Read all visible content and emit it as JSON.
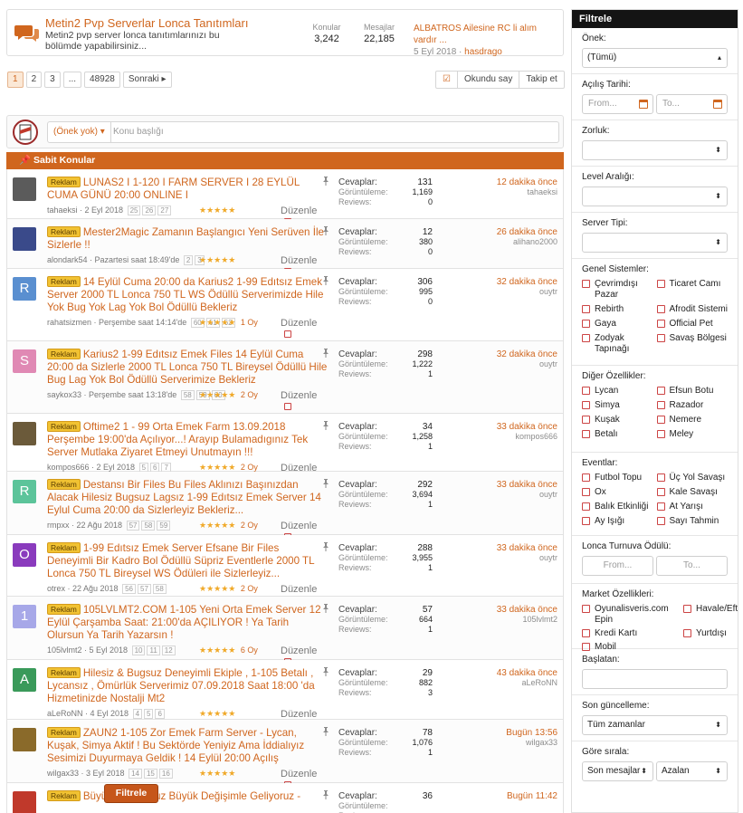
{
  "forum": {
    "title": "Metin2 Pvp Serverlar Lonca Tanıtımları",
    "description": "Metin2 pvp server lonca tanıtımlarınızı bu bölümde yapabilirsiniz...",
    "topics_label": "Konular",
    "topics_value": "3,242",
    "messages_label": "Mesajlar",
    "messages_value": "22,185",
    "last_title": "ALBATROS Ailesine RC li alım vardır ...",
    "last_date": "5 Eyl 2018",
    "last_user": "hasdrago"
  },
  "pagination": {
    "pages": [
      "1",
      "2",
      "3",
      "...",
      "48928"
    ],
    "next": "Sonraki"
  },
  "tools": {
    "mark_read": "Okundu say",
    "follow": "Takip et"
  },
  "search": {
    "prefix": "(Önek yok)",
    "placeholder": "Konu başlığı"
  },
  "sticky_header": "Sabit Konular",
  "stat_labels": {
    "replies": "Cevaplar:",
    "views": "Görüntüleme:",
    "reviews": "Reviews:"
  },
  "edit_label": "Düzenle",
  "badge_label": "Reklam",
  "threads": [
    {
      "title": "LUNAS2 I 1-120 I FARM SERVER I 28 EYLÜL CUMA GÜNÜ 20:00 ONLINE I",
      "author": "tahaeksi",
      "date": "2 Eyl 2018",
      "pages": [
        "25",
        "26",
        "27"
      ],
      "votes": "",
      "replies": "131",
      "views": "1,169",
      "reviews": "0",
      "last_time": "12 dakika önce",
      "last_user": "tahaeksi",
      "avatar_letter": "",
      "avatar_color": "#5b5b5b",
      "height": 55
    },
    {
      "title": "Mester2Magic Zamanın Başlangıcı Yeni Serüven İle Sizlerle !!",
      "author": "alondark54",
      "date": "Pazartesi saat 18:49'de",
      "pages": [
        "2",
        "3"
      ],
      "votes": "",
      "replies": "12",
      "views": "380",
      "reviews": "0",
      "last_time": "26 dakika önce",
      "last_user": "alihano2000",
      "avatar_letter": "",
      "avatar_color": "#3a4a8a",
      "height": 55
    },
    {
      "title": "14 Eylül Cuma 20:00 da Karius2 1-99 Edıtsız Emek Server 2000 TL Lonca 750 TL WS Ödüllü Serverimizde Hile Yok Bug Yok Lag Yok Bol Ödüllü Bekleriz",
      "author": "rahatsizmen",
      "date": "Perşembe saat 14:14'de",
      "pages": [
        "60",
        "61",
        "62"
      ],
      "votes": "1 Oy",
      "replies": "306",
      "views": "995",
      "reviews": "0",
      "last_time": "32 dakika önce",
      "last_user": "ouytr",
      "avatar_letter": "R",
      "avatar_color": "#5a8fd0",
      "height": 80
    },
    {
      "title": "Karius2 1-99 Edıtsız Emek Files 14 Eylül Cuma 20:00 da Sizlerle 2000 TL Lonca 750 TL Bireysel Ödüllü Hile Bug Lag Yok Bol Ödüllü Serverimize Bekleriz",
      "author": "saykox33",
      "date": "Perşembe saat 13:18'de",
      "pages": [
        "58",
        "59",
        "60"
      ],
      "votes": "2 Oy",
      "replies": "298",
      "views": "1,222",
      "reviews": "1",
      "last_time": "32 dakika önce",
      "last_user": "ouytr",
      "avatar_letter": "S",
      "avatar_color": "#e089b4",
      "height": 80
    },
    {
      "title": "Oftime2 1 - 99 Orta Emek Farm 13.09.2018 Perşembe 19:00'da Açılıyor...! Arayıp Bulamadıgınız Tek Server Mutlaka Ziyaret Etmeyi Unutmayın !!!",
      "author": "kompos666",
      "date": "2 Eyl 2018",
      "pages": [
        "5",
        "6",
        "7"
      ],
      "votes": "2 Oy",
      "replies": "34",
      "views": "1,258",
      "reviews": "1",
      "last_time": "33 dakika önce",
      "last_user": "kompos666",
      "avatar_letter": "",
      "avatar_color": "#6b5a3a",
      "height": 64
    },
    {
      "title": "Destansı Bir Files Bu Files Aklınızı Başınızdan Alacak Hilesiz Bugsuz Lagsız 1-99 Edıtsız Emek Server 14 Eylul Cuma 20:00 da Sizlerleyiz Bekleriz...",
      "author": "rmpxx",
      "date": "22 Ağu 2018",
      "pages": [
        "57",
        "58",
        "59"
      ],
      "votes": "2 Oy",
      "replies": "292",
      "views": "3,694",
      "reviews": "1",
      "last_time": "33 dakika önce",
      "last_user": "ouytr",
      "avatar_letter": "R",
      "avatar_color": "#5cc49a",
      "height": 70
    },
    {
      "title": "1-99 Edıtsız Emek Server Efsane Bir Files Deneyimli Bir Kadro Bol Ödüllü Süpriz Eventlerle 2000 TL Lonca 750 TL Bireysel WS Ödüleri ile Sizlerleyiz...",
      "author": "otrex",
      "date": "22 Ağu 2018",
      "pages": [
        "56",
        "57",
        "58"
      ],
      "votes": "2 Oy",
      "replies": "288",
      "views": "3,955",
      "reviews": "1",
      "last_time": "33 dakika önce",
      "last_user": "ouytr",
      "avatar_letter": "O",
      "avatar_color": "#8a3bbd",
      "height": 68
    },
    {
      "title": "105LVLMT2.COM 1-105 Yeni Orta Emek Server 12 Eylül Çarşamba Saat: 21:00'da AÇILIYOR ! Ya Tarih Olursun Ya Tarih Yazarsın !",
      "author": "105lvlmt2",
      "date": "5 Eyl 2018",
      "pages": [
        "10",
        "11",
        "12"
      ],
      "votes": "6 Oy",
      "replies": "57",
      "views": "664",
      "reviews": "1",
      "last_time": "33 dakika önce",
      "last_user": "105lvlmt2",
      "avatar_letter": "1",
      "avatar_color": "#a7a8e8",
      "height": 70
    },
    {
      "title": "Hilesiz & Bugsuz Deneyimli Ekiple , 1-105 Betalı , Lycansız , Ömürlük Serverimiz 07.09.2018 Saat 18:00 'da Hizmetinizde Nostalji Mt2",
      "author": "aLeRoNN",
      "date": "4 Eyl 2018",
      "pages": [
        "4",
        "5",
        "6"
      ],
      "votes": "",
      "replies": "29",
      "views": "882",
      "reviews": "3",
      "last_time": "43 dakika önce",
      "last_user": "aLeRoNN",
      "avatar_letter": "A",
      "avatar_color": "#3a9a5a",
      "height": 66
    },
    {
      "title": "ZAUN2 1-105 Zor Emek Farm Server - Lycan, Kuşak, Simya Aktif ! Bu Sektörde Yeniyiz Ama İddialıyız Sesimizi Duyurmaya Geldik ! 14 Eylül 20:00 Açılış",
      "author": "wilgax33",
      "date": "3 Eyl 2018",
      "pages": [
        "14",
        "15",
        "16"
      ],
      "votes": "",
      "replies": "78",
      "views": "1,076",
      "reviews": "1",
      "last_time": "Bugün 13:56",
      "last_user": "wilgax33",
      "avatar_letter": "",
      "avatar_color": "#8a6a2a",
      "height": 70
    },
    {
      "title": "Büyük Oynuyoruz Büyük Değişimle Geliyoruz -",
      "author": "",
      "date": "",
      "pages": [],
      "votes": "",
      "replies": "36",
      "views": "",
      "reviews": "",
      "last_time": "Bugün 11:42",
      "last_user": "",
      "avatar_letter": "",
      "avatar_color": "#c0392b",
      "height": 40
    }
  ],
  "sidebar": {
    "title": "Filtrele",
    "prefix_label": "Önek:",
    "prefix_value": "(Tümü)",
    "open_date_label": "Açılış Tarihi:",
    "from_ph": "From...",
    "to_ph": "To...",
    "difficulty_label": "Zorluk:",
    "level_label": "Level Aralığı:",
    "server_type_label": "Server Tipi:",
    "general_label": "Genel Sistemler:",
    "general": [
      "Çevrimdışı Pazar",
      "Ticaret Camı",
      "Rebirth",
      "Afrodit Sistemi",
      "Gaya",
      "Official Pet",
      "Zodyak Tapınağı",
      "Savaş Bölgesi"
    ],
    "other_label": "Diğer Özellikler:",
    "other": [
      "Lycan",
      "Efsun Botu",
      "Simya",
      "Razador",
      "Kuşak",
      "Nemere",
      "Betalı",
      "Meley"
    ],
    "events_label": "Eventlar:",
    "events": [
      "Futbol Topu",
      "Üç Yol Savaşı",
      "Ox",
      "Kale Savaşı",
      "Balık Etkinliği",
      "At Yarışı",
      "Ay Işığı",
      "Sayı Tahmin"
    ],
    "guild_label": "Lonca Turnuva Ödülü:",
    "market_label": "Market Özellikleri:",
    "market": [
      "Oyunalisveris.com Epin",
      "Havale/Eft",
      "Kredi Kartı",
      "Yurtdışı",
      "Mobil"
    ],
    "title_label": "Başlatan:",
    "last_update_label": "Son güncelleme:",
    "last_update_value": "Tüm zamanlar",
    "sort_label": "Göre sırala:",
    "sort_value": "Son mesajlar",
    "order_value": "Azalan",
    "submit": "Filtrele"
  }
}
